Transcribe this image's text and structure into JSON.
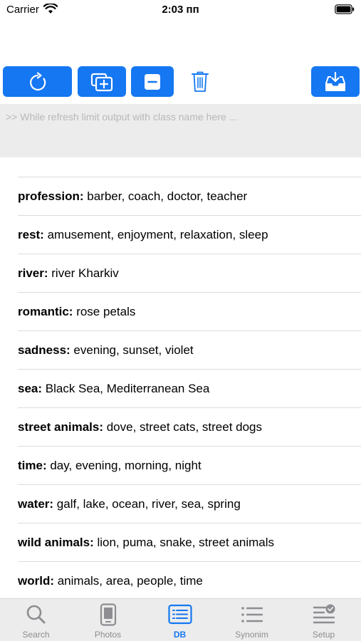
{
  "status_bar": {
    "carrier": "Carrier",
    "time": "2:03 пп"
  },
  "toolbar": {
    "buttons": [
      {
        "name": "refresh",
        "icon": "refresh-icon"
      },
      {
        "name": "add",
        "icon": "add-copy-icon"
      },
      {
        "name": "remove",
        "icon": "minus-icon"
      },
      {
        "name": "trash",
        "icon": "trash-icon"
      },
      {
        "name": "download",
        "icon": "tray-download-icon"
      }
    ],
    "accent": "#1577f2"
  },
  "console": {
    "placeholder": ">> While refresh limit output with class name here ..."
  },
  "list": {
    "partial_top": "-            -",
    "rows": [
      {
        "key": "profession:",
        "value": " barber, coach, doctor, teacher"
      },
      {
        "key": "rest:",
        "value": " amusement, enjoyment, relaxation, sleep"
      },
      {
        "key": "river:",
        "value": " river Kharkiv"
      },
      {
        "key": "romantic:",
        "value": " rose petals"
      },
      {
        "key": "sadness:",
        "value": " evening, sunset, violet"
      },
      {
        "key": "sea:",
        "value": " Black Sea, Mediterranean Sea"
      },
      {
        "key": "street animals:",
        "value": " dove, street cats, street dogs"
      },
      {
        "key": "time:",
        "value": " day, evening, morning, night"
      },
      {
        "key": "water:",
        "value": " galf, lake, ocean, river, sea, spring"
      },
      {
        "key": "wild animals:",
        "value": " lion, puma, snake, street animals"
      },
      {
        "key": "world:",
        "value": " animals, area, people, time"
      }
    ]
  },
  "tabbar": {
    "tabs": [
      {
        "label": "Search",
        "icon": "magnifier-icon",
        "active": false
      },
      {
        "label": "Photos",
        "icon": "phone-photos-icon",
        "active": false
      },
      {
        "label": "DB",
        "icon": "database-list-icon",
        "active": true
      },
      {
        "label": "Synonim",
        "icon": "bulleted-list-icon",
        "active": false
      },
      {
        "label": "Setup",
        "icon": "checklist-settings-icon",
        "active": false
      }
    ],
    "active_color": "#1577f2",
    "inactive_color": "#8d8d92"
  }
}
